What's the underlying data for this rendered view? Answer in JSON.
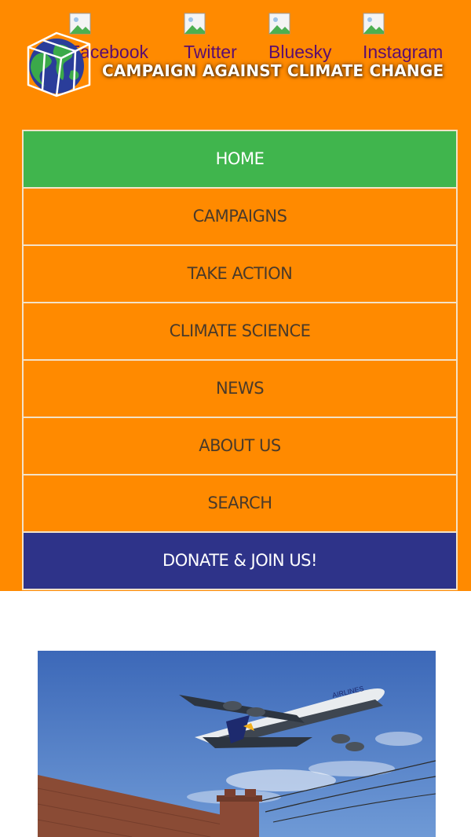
{
  "social_links": [
    {
      "label": "Facebook",
      "icon": "broken-image-icon"
    },
    {
      "label": "Twitter",
      "icon": "broken-image-icon"
    },
    {
      "label": "Bluesky",
      "icon": "broken-image-icon"
    },
    {
      "label": "Instagram",
      "icon": "broken-image-icon"
    }
  ],
  "site_title": "CAMPAIGN AGAINST CLIMATE CHANGE",
  "nav": {
    "items": [
      {
        "label": "HOME"
      },
      {
        "label": "CAMPAIGNS"
      },
      {
        "label": "TAKE ACTION"
      },
      {
        "label": "CLIMATE SCIENCE"
      },
      {
        "label": "NEWS"
      },
      {
        "label": "ABOUT US"
      },
      {
        "label": "SEARCH"
      },
      {
        "label": "DONATE & JOIN US!"
      }
    ]
  },
  "colors": {
    "header_bg": "#ff8a00",
    "home_active": "#40b54d",
    "donate": "#2e3389",
    "social_text": "#5b0d6f"
  },
  "hero_image": {
    "text": "AIRLINES"
  }
}
